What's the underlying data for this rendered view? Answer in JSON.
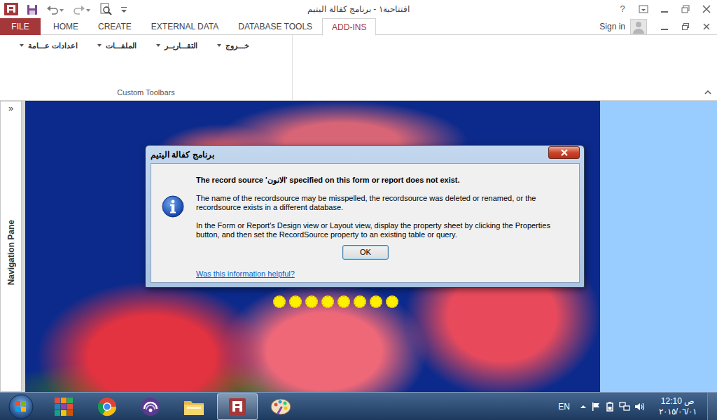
{
  "window": {
    "title": "افتتاحية١ - برنامج كفالة اليتيم",
    "help": "?"
  },
  "ribbon": {
    "tabs": [
      {
        "label": "FILE",
        "selected": false,
        "kind": "backstage"
      },
      {
        "label": "HOME",
        "selected": false,
        "kind": "tab"
      },
      {
        "label": "CREATE",
        "selected": false,
        "kind": "tab"
      },
      {
        "label": "EXTERNAL DATA",
        "selected": false,
        "kind": "tab"
      },
      {
        "label": "DATABASE TOOLS",
        "selected": false,
        "kind": "tab"
      },
      {
        "label": "ADD-INS",
        "selected": true,
        "kind": "tab"
      }
    ],
    "account": {
      "label": "Sign in"
    },
    "group": {
      "label": "Custom Toolbars",
      "menus": [
        {
          "label": "اعدادات عـــامة"
        },
        {
          "label": "الملفـــات"
        },
        {
          "label": "التقـــاريــر"
        },
        {
          "label": "خـــروج"
        }
      ]
    }
  },
  "navigation_pane": {
    "toggle": "»",
    "label": "Navigation Pane",
    "expanded": false
  },
  "form": {
    "progress": {
      "dots": 8
    }
  },
  "dialog": {
    "title": "برنامج كفالة اليتيم",
    "heading": "The record source 'الانون' specified on this form or report does not exist.",
    "paragraphs": [
      "The name of the recordsource may be misspelled, the recordsource was deleted or renamed, or the recordsource exists in a different database.",
      "In the Form or Report's Design view or Layout view, display the property sheet by clicking the Properties button, and then set the RecordSource property to an existing table or query."
    ],
    "buttons": [
      "OK"
    ],
    "link": "Was this information helpful?"
  },
  "taskbar": {
    "apps": [
      {
        "kind": "apps",
        "selected": false
      },
      {
        "kind": "chrome",
        "selected": false
      },
      {
        "kind": "torrent",
        "selected": false
      },
      {
        "kind": "explorer",
        "selected": false
      },
      {
        "kind": "access",
        "selected": true
      },
      {
        "kind": "paint",
        "selected": false
      }
    ],
    "language": "EN",
    "time": "ص 12:10",
    "date": "٢٠١٥/٠٦/٠١"
  }
}
